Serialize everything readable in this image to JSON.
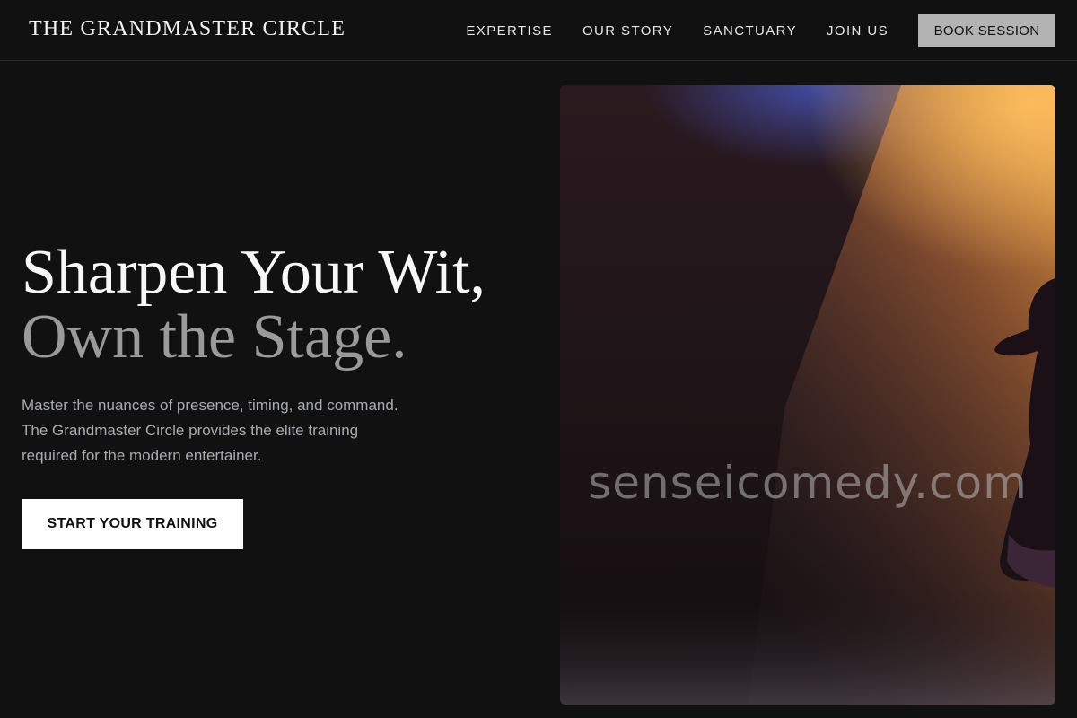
{
  "brand": {
    "name": "THE GRANDMASTER CIRCLE"
  },
  "nav": {
    "links": [
      "EXPERTISE",
      "OUR STORY",
      "SANCTUARY",
      "JOIN US"
    ],
    "cta_label": "BOOK SESSION"
  },
  "hero": {
    "headline_line1": "Sharpen Your Wit,",
    "headline_line2": "Own the Stage.",
    "description": "Master the nuances of presence, timing, and command. The Grandmaster Circle provides the elite training required for the modern entertainer.",
    "cta_label": "START YOUR TRAINING",
    "photo_watermark": "senseicomedy.com"
  },
  "colors": {
    "background": "#111111",
    "headline_primary": "#f7f7f7",
    "headline_secondary": "#9a9a9a",
    "body_text": "#a8abb0",
    "nav_cta_background": "#b3b3b3",
    "hero_cta_background": "#ffffff",
    "spotlight": "#e08a2c"
  }
}
